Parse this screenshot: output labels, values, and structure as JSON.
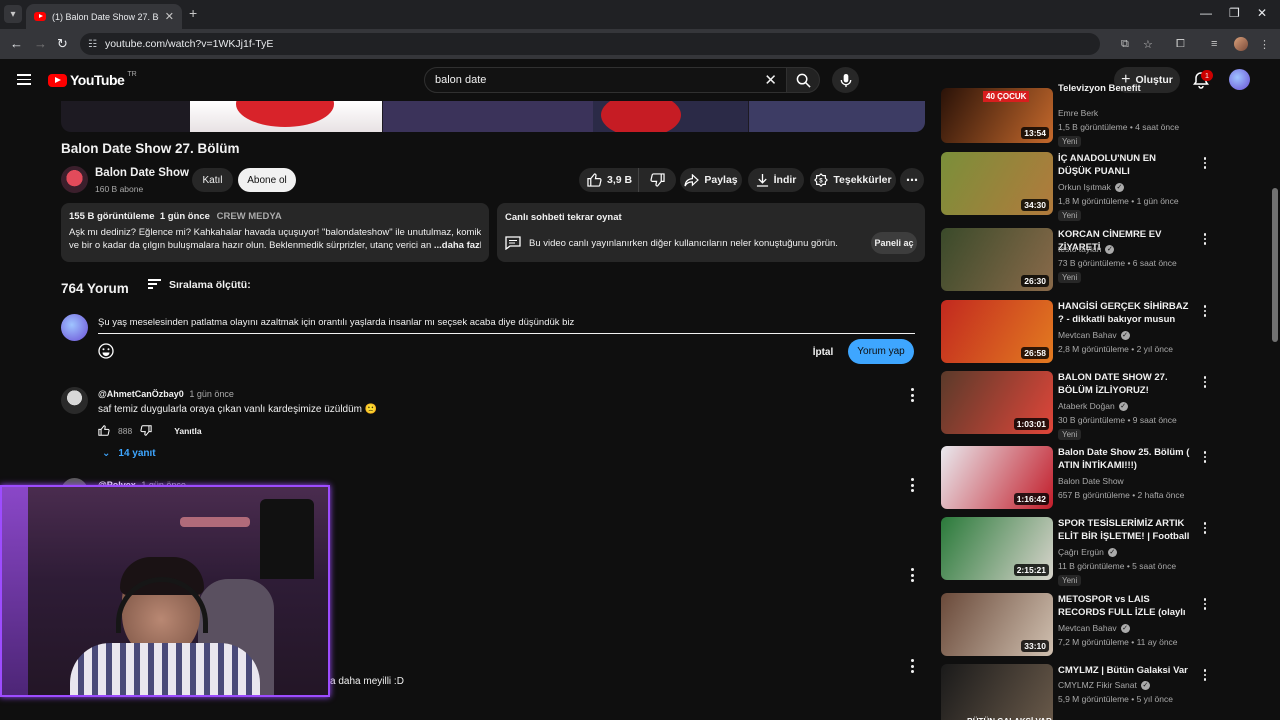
{
  "browser": {
    "tab_title": "(1) Balon Date Show 27. Bölüm",
    "url": "youtube.com/watch?v=1WKJj1f-TyE",
    "accent": "#35363a"
  },
  "header": {
    "logo_text": "YouTube",
    "region": "TR",
    "search_value": "balon date",
    "create_label": "Oluştur",
    "notification_count": "1"
  },
  "video": {
    "title": "Balon Date Show 27. Bölüm",
    "channel_name": "Balon Date Show",
    "subscribers": "160 B abone",
    "join_label": "Katıl",
    "subscribe_label": "Abone ol",
    "likes": "3,9 B",
    "share_label": "Paylaş",
    "download_label": "İndir",
    "thanks_label": "Teşekkürler"
  },
  "description": {
    "views": "155 B görüntüleme",
    "age": "1 gün önce",
    "tagline": "CREW MEDYA",
    "line1": "Aşk mı dediniz? Eğlence mi? Kahkahalar havada uçuşuyor! \"balondateshow\" ile unutulmaz, komik",
    "line2": "ve bir o kadar da çılgın buluşmalara hazır olun. Beklenmedik sürprizler, utanç verici an",
    "more": "...daha fazla"
  },
  "chat_replay": {
    "title": "Canlı sohbeti tekrar oynat",
    "text": "Bu video canlı yayınlanırken diğer kullanıcıların neler konuştuğunu görün.",
    "button": "Paneli aç"
  },
  "comments": {
    "count": "764 Yorum",
    "sort_label": "Sıralama ölçütü:",
    "draft": "Şu yaş meselesinden patlatma olayını azaltmak için orantılı yaşlarda insanlar mı seçsek acaba diye düşündük biz",
    "cancel_label": "İptal",
    "post_label": "Yorum yap",
    "items": [
      {
        "author": "@AhmetCanÖzbay0",
        "time": "1 gün önce",
        "text": "saf temiz duygularla oraya çıkan vanlı kardeşimize üzüldüm 🙁",
        "likes": "888",
        "reply_label": "Yanıtla",
        "replies": "14 yanıt"
      },
      {
        "author": "@Polvex",
        "time": "1 gün önce"
      }
    ],
    "partial_text": "a daha meyilli :D"
  },
  "sidebar": [
    {
      "title": "Televizyon Benefit",
      "channel": "Emre Berk",
      "verified": false,
      "meta": "1,5 B görüntüleme • 4 saat önce",
      "new": "Yeni",
      "duration": "13:54",
      "badge": "40 ÇOCUK",
      "colors": [
        "#2a1208",
        "#c5692c"
      ]
    },
    {
      "title": "İÇ ANADOLU'NUN EN DÜŞÜK PUANLI RESTORANTLARI! ft. ...",
      "channel": "Orkun Işıtmak",
      "verified": true,
      "meta": "1,8 M görüntüleme • 1 gün önce",
      "new": "Yeni",
      "duration": "34:30",
      "colors": [
        "#7a8f3a",
        "#b27a3c"
      ]
    },
    {
      "title": "KORCAN CİNEMRE EV ZİYARETİ",
      "channel": "testo taylan",
      "verified": true,
      "meta": "73 B görüntüleme • 6 saat önce",
      "new": "Yeni",
      "duration": "26:30",
      "colors": [
        "#3a4a2a",
        "#8a6a4a"
      ]
    },
    {
      "title": "HANGİSİ GERÇEK SİHİRBAZ ? - dikkatli bakıyor musun kanki?",
      "channel": "Mevtcan Bahav",
      "verified": true,
      "meta": "2,8 M görüntüleme • 2 yıl önce",
      "new": "",
      "duration": "26:58",
      "colors": [
        "#c2291f",
        "#e37b20"
      ]
    },
    {
      "title": "BALON DATE SHOW 27. BÖLÜM İZLİYORUZ!",
      "channel": "Ataberk Doğan",
      "verified": true,
      "meta": "30 B görüntüleme • 9 saat önce",
      "new": "Yeni",
      "duration": "1:03:01",
      "colors": [
        "#5a3a2a",
        "#e0463a"
      ]
    },
    {
      "title": "Balon Date Show 25. Bölüm ( ATIN İNTİKAMI!!!)",
      "channel": "Balon Date Show",
      "verified": false,
      "meta": "657 B görüntüleme • 2 hafta önce",
      "new": "",
      "duration": "1:16:42",
      "colors": [
        "#e9e9ee",
        "#c21d2a"
      ]
    },
    {
      "title": "SPOR TESİSLERİMİZ ARTIK ELİT BİR İŞLETME! | Football ...",
      "channel": "Çağrı Ergün",
      "verified": true,
      "meta": "11 B görüntüleme • 5 saat önce",
      "new": "Yeni",
      "duration": "2:15:21",
      "colors": [
        "#2a7a3a",
        "#d8d4cc"
      ]
    },
    {
      "title": "METOSPOR vs LAIS RECORDS FULL İZLE (olaylı maç)",
      "channel": "Mevtcan Bahav",
      "verified": true,
      "meta": "7,2 M görüntüleme • 11 ay önce",
      "new": "",
      "duration": "33:10",
      "colors": [
        "#6a4a3a",
        "#d0c0b0"
      ]
    },
    {
      "title": "CMYLMZ | Bütün Galaksi Var",
      "channel": "CMYLMZ Fikir Sanat",
      "verified": true,
      "meta": "5,9 M görüntüleme • 5 yıl önce",
      "new": "",
      "duration": "",
      "badge": "BÜTÜN GALAKSİ VAR",
      "colors": [
        "#1a1a1a",
        "#6a5a4a"
      ]
    }
  ]
}
